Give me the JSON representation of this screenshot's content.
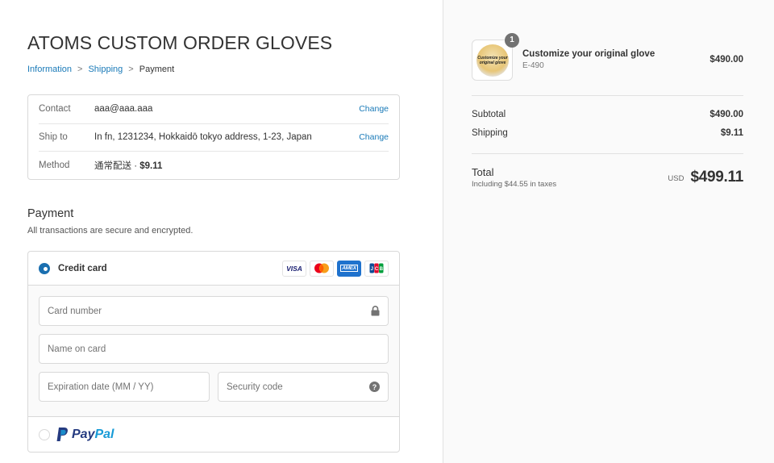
{
  "store": {
    "title": "ATOMS CUSTOM ORDER GLOVES"
  },
  "breadcrumb": [
    {
      "label": "Information"
    },
    {
      "label": "Shipping"
    },
    {
      "label": "Payment"
    }
  ],
  "review": {
    "contact": {
      "label": "Contact",
      "value": "aaa@aaa.aaa",
      "action": "Change"
    },
    "ship_to": {
      "label": "Ship to",
      "value": "In fn, 1231234, Hokkaidō tokyo address, 1-23, Japan",
      "action": "Change"
    },
    "method": {
      "label": "Method",
      "name": "通常配送",
      "separator": " · ",
      "price": "$9.11"
    }
  },
  "payment": {
    "title": "Payment",
    "subtitle": "All transactions are secure and encrypted.",
    "credit_card": {
      "label": "Credit card",
      "selected": true,
      "brands": [
        {
          "name": "visa",
          "text": "VISA"
        },
        {
          "name": "mastercard",
          "text": ""
        },
        {
          "name": "amex",
          "text": "AMEX"
        },
        {
          "name": "jcb",
          "text": "JCB"
        }
      ],
      "fields": {
        "card_number": {
          "placeholder": "Card number",
          "icon": "lock-icon"
        },
        "name_on_card": {
          "placeholder": "Name on card"
        },
        "expiration": {
          "placeholder": "Expiration date (MM / YY)"
        },
        "security_code": {
          "placeholder": "Security code",
          "icon": "help-icon",
          "icon_text": "?"
        }
      }
    },
    "paypal": {
      "selected": false,
      "text_1": "Pay",
      "text_2": "Pal"
    }
  },
  "summary": {
    "item": {
      "name": "Customize your original glove",
      "sku": "E-490",
      "price": "$490.00",
      "quantity": "1",
      "thumb_text": "Customize your original glove"
    },
    "subtotal": {
      "label": "Subtotal",
      "value": "$490.00"
    },
    "shipping": {
      "label": "Shipping",
      "value": "$9.11"
    },
    "total": {
      "label": "Total",
      "tax_note": "Including $44.55 in taxes",
      "currency": "USD",
      "value": "$499.11"
    }
  },
  "colors": {
    "accent": "#1a7ab8",
    "radio_selected": "#1a6fb0",
    "sidebar_bg": "#fafafa",
    "paypal_dark": "#253b80",
    "paypal_light": "#179bd7"
  }
}
